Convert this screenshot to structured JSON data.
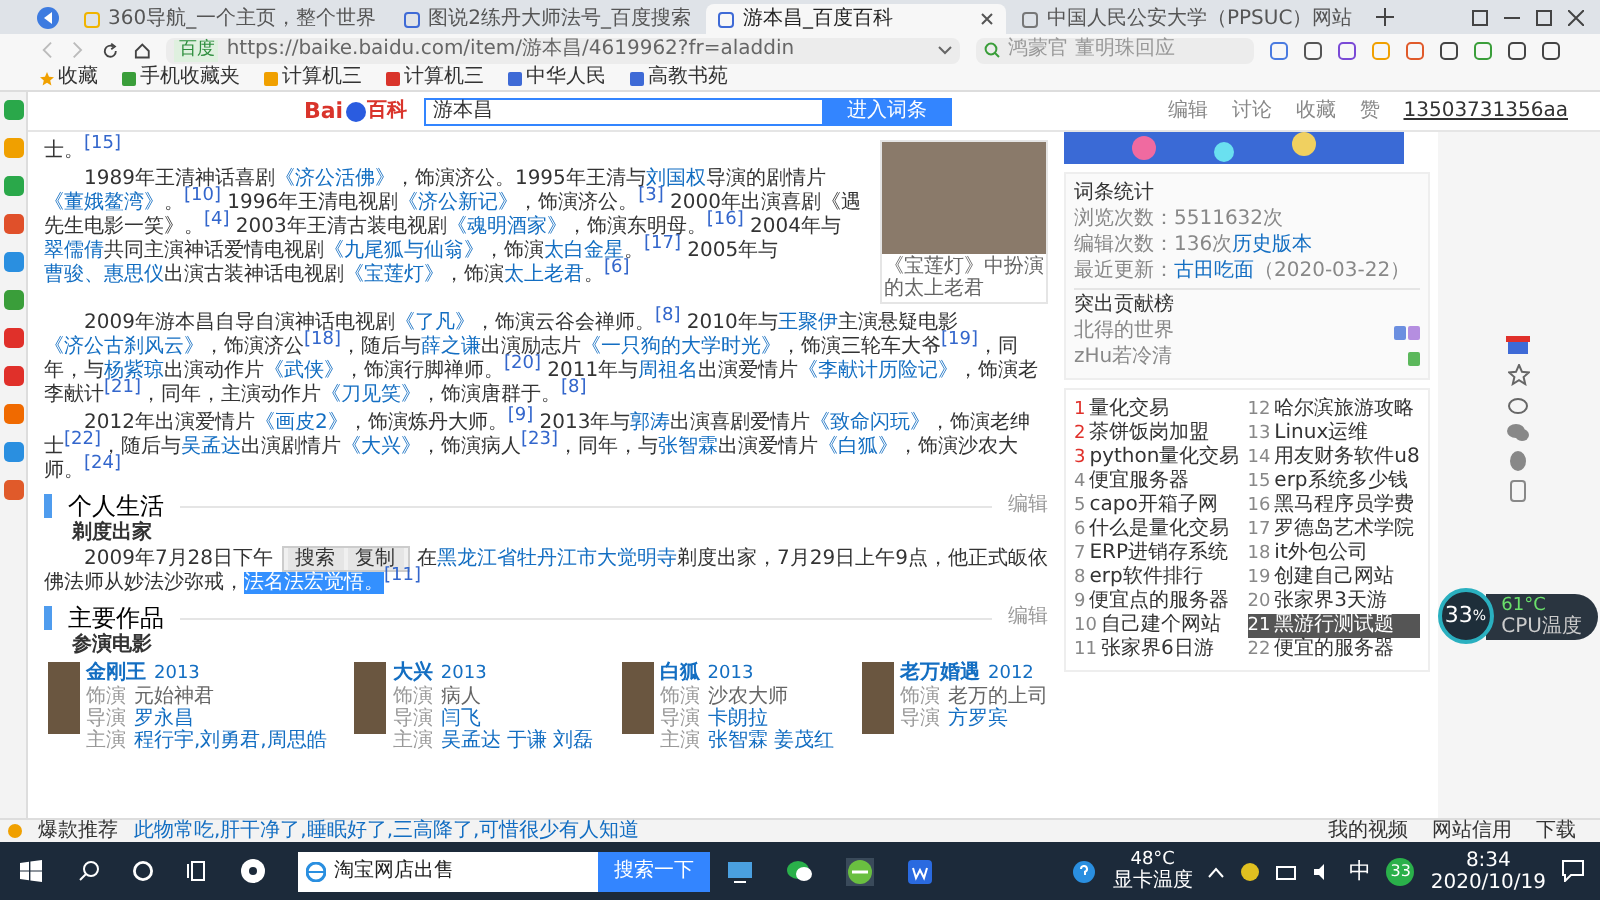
{
  "browser": {
    "tabs": [
      {
        "title": "360导航_一个主页，整个世界",
        "selected": false
      },
      {
        "title": "图说2练丹大师法号_百度搜索",
        "selected": false
      },
      {
        "title": "游本昌_百度百科",
        "selected": true
      },
      {
        "title": "中国人民公安大学（PPSUC）网站",
        "selected": false
      }
    ],
    "site_label": "百度",
    "url": "https://baike.baidu.com/item/游本昌/4619962?fr=aladdin",
    "search_placeholder": "鸿蒙官 董明珠回应",
    "bookmarks": [
      "收藏",
      "手机收藏夹",
      "计算机三",
      "计算机三",
      "中华人民",
      "高教书苑"
    ]
  },
  "header": {
    "logo_text": "Bai",
    "logo_suffix": "百科",
    "search_value": "游本昌",
    "search_button": "进入词条",
    "actions": [
      "编辑",
      "讨论",
      "收藏",
      "赞"
    ],
    "user": "13503731356aa"
  },
  "article": {
    "photo_caption": "《宝莲灯》中扮演的太上老君",
    "beside_photo": [
      {
        "kind": "paragraph",
        "indent": false,
        "segments": [
          {
            "kind": "plain",
            "text": "士。"
          },
          {
            "kind": "ref",
            "text": "[15]"
          }
        ]
      },
      {
        "kind": "paragraph",
        "indent": true,
        "segments": [
          {
            "kind": "plain",
            "text": "1989年王清神话喜剧"
          },
          {
            "kind": "link",
            "text": "《济公活佛》"
          },
          {
            "kind": "plain",
            "text": "，饰演济公。1995年王清与"
          },
          {
            "kind": "link",
            "text": "刘国权"
          },
          {
            "kind": "plain",
            "text": "导演的剧情片"
          },
          {
            "kind": "link",
            "text": "《董娥鳌湾》"
          },
          {
            "kind": "plain",
            "text": "。"
          },
          {
            "kind": "ref",
            "text": "[10]"
          },
          {
            "kind": "plain",
            "text": " 1996年王清电视剧"
          },
          {
            "kind": "link",
            "text": "《济公新记》"
          },
          {
            "kind": "plain",
            "text": "，饰演济公。"
          },
          {
            "kind": "ref",
            "text": "[3]"
          },
          {
            "kind": "plain",
            "text": " 2000年出演喜剧《遇先生电影一笑》。"
          },
          {
            "kind": "ref",
            "text": "[4]"
          },
          {
            "kind": "plain",
            "text": " 2003年王清古装电视剧"
          },
          {
            "kind": "link",
            "text": "《魂明酒家》"
          },
          {
            "kind": "plain",
            "text": "，饰演东明母。"
          },
          {
            "kind": "ref",
            "text": "[16]"
          },
          {
            "kind": "plain",
            "text": " 2004年与"
          },
          {
            "kind": "link",
            "text": "翠儒倩"
          },
          {
            "kind": "plain",
            "text": "共同主演神话爱情电视剧"
          },
          {
            "kind": "link",
            "text": "《九尾狐与仙翁》"
          },
          {
            "kind": "plain",
            "text": "，饰演"
          },
          {
            "kind": "link",
            "text": "太白金星"
          },
          {
            "kind": "plain",
            "text": "。"
          },
          {
            "kind": "ref",
            "text": "[17]"
          },
          {
            "kind": "plain",
            "text": " 2005年与"
          },
          {
            "kind": "link",
            "text": "曹骏、惠思仪"
          },
          {
            "kind": "plain",
            "text": "出演古装神话电视剧"
          },
          {
            "kind": "link",
            "text": "《宝莲灯》"
          },
          {
            "kind": "plain",
            "text": "，饰演"
          },
          {
            "kind": "link",
            "text": "太上老君"
          },
          {
            "kind": "plain",
            "text": "。"
          },
          {
            "kind": "ref",
            "text": "[6]"
          }
        ]
      }
    ],
    "blocks": [
      {
        "kind": "paragraph",
        "indent": true,
        "segments": [
          {
            "kind": "plain",
            "text": "2009年游本昌自导自演神话电视剧"
          },
          {
            "kind": "link",
            "text": "《了凡》"
          },
          {
            "kind": "plain",
            "text": "，饰演云谷会禅师。"
          },
          {
            "kind": "ref",
            "text": "[8]"
          },
          {
            "kind": "plain",
            "text": " 2010年与"
          },
          {
            "kind": "link",
            "text": "王聚伊"
          },
          {
            "kind": "plain",
            "text": "主演悬疑电影"
          },
          {
            "kind": "link",
            "text": "《济公古刹风云》"
          },
          {
            "kind": "plain",
            "text": "，饰演济公"
          },
          {
            "kind": "ref",
            "text": "[18]"
          },
          {
            "kind": "plain",
            "text": "，随后与"
          },
          {
            "kind": "link",
            "text": "薛之谦"
          },
          {
            "kind": "plain",
            "text": "出演励志片"
          },
          {
            "kind": "link",
            "text": "《一只狗的大学时光》"
          },
          {
            "kind": "plain",
            "text": "，饰演三轮车大爷"
          },
          {
            "kind": "ref",
            "text": "[19]"
          },
          {
            "kind": "plain",
            "text": "，同年，与"
          },
          {
            "kind": "link",
            "text": "杨紫琼"
          },
          {
            "kind": "plain",
            "text": "出演动作片"
          },
          {
            "kind": "link",
            "text": "《武侠》"
          },
          {
            "kind": "plain",
            "text": "，饰演行脚禅师。"
          },
          {
            "kind": "ref",
            "text": "[20]"
          },
          {
            "kind": "plain",
            "text": " 2011年与"
          },
          {
            "kind": "link",
            "text": "周祖名"
          },
          {
            "kind": "plain",
            "text": "出演爱情片"
          },
          {
            "kind": "link",
            "text": "《李献计历险记》"
          },
          {
            "kind": "plain",
            "text": "，饰演老李献计"
          },
          {
            "kind": "ref",
            "text": "[21]"
          },
          {
            "kind": "plain",
            "text": "，同年，主演动作片"
          },
          {
            "kind": "link",
            "text": "《刀见笑》"
          },
          {
            "kind": "plain",
            "text": "，饰演唐群于。"
          },
          {
            "kind": "ref",
            "text": "[8]"
          }
        ]
      },
      {
        "kind": "paragraph",
        "indent": true,
        "segments": [
          {
            "kind": "plain",
            "text": "2012年出演爱情片"
          },
          {
            "kind": "link",
            "text": "《画皮2》"
          },
          {
            "kind": "plain",
            "text": "，饰演炼丹大师。"
          },
          {
            "kind": "ref",
            "text": "[9]"
          },
          {
            "kind": "plain",
            "text": " 2013年与"
          },
          {
            "kind": "link",
            "text": "郭涛"
          },
          {
            "kind": "plain",
            "text": "出演喜剧爱情片"
          },
          {
            "kind": "link",
            "text": "《致命闪玩》"
          },
          {
            "kind": "plain",
            "text": "，饰演老绅士"
          },
          {
            "kind": "ref",
            "text": "[22]"
          },
          {
            "kind": "plain",
            "text": "，随后与"
          },
          {
            "kind": "link",
            "text": "吴孟达"
          },
          {
            "kind": "plain",
            "text": "出演剧情片"
          },
          {
            "kind": "link",
            "text": "《大兴》"
          },
          {
            "kind": "plain",
            "text": "，饰演病人"
          },
          {
            "kind": "ref",
            "text": "[23]"
          },
          {
            "kind": "plain",
            "text": "，同年，与"
          },
          {
            "kind": "link",
            "text": "张智霖"
          },
          {
            "kind": "plain",
            "text": "出演爱情片"
          },
          {
            "kind": "link",
            "text": "《白狐》"
          },
          {
            "kind": "plain",
            "text": "，饰演沙农大师。"
          },
          {
            "kind": "ref",
            "text": "[24]"
          }
        ]
      },
      {
        "kind": "heading",
        "text": "个人生活",
        "edit": "编辑"
      },
      {
        "kind": "subheading",
        "text": "剃度出家"
      },
      {
        "kind": "paragraph",
        "indent": true,
        "segments": [
          {
            "kind": "plain",
            "text": "2009年7月28日下午"
          },
          {
            "kind": "popup",
            "buttons": [
              "搜索",
              "复制"
            ]
          },
          {
            "kind": "plain",
            "text": "在"
          },
          {
            "kind": "link",
            "text": "黑龙江省"
          },
          {
            "kind": "link",
            "text": "牡丹江市大觉明寺"
          },
          {
            "kind": "plain",
            "text": "剃度出家，7月29日上午9点，他正式皈依佛法师从妙法沙弥戒，"
          },
          {
            "kind": "selected",
            "text": "法名法宏觉悟。"
          },
          {
            "kind": "ref",
            "text": "[11]"
          }
        ]
      },
      {
        "kind": "heading",
        "text": "主要作品",
        "edit": "编辑"
      },
      {
        "kind": "subheading",
        "text": "参演电影"
      },
      {
        "kind": "movies",
        "items": [
          {
            "title": "金刚王",
            "year": "2013",
            "fields": [
              {
                "label": "饰演",
                "value": "元始神君",
                "link": false
              },
              {
                "label": "导演",
                "value": "罗永昌",
                "link": true
              },
              {
                "label": "主演",
                "value": "程行宇,刘勇君,周思皓",
                "link": true
              }
            ]
          },
          {
            "title": "大兴",
            "year": "2013",
            "fields": [
              {
                "label": "饰演",
                "value": "病人",
                "link": false
              },
              {
                "label": "导演",
                "value": "闫飞",
                "link": true
              },
              {
                "label": "主演",
                "value": "吴孟达 于谦 刘磊",
                "link": true
              }
            ]
          },
          {
            "title": "白狐",
            "year": "2013",
            "fields": [
              {
                "label": "饰演",
                "value": "沙农大师",
                "link": false
              },
              {
                "label": "导演",
                "value": "卡朗拉",
                "link": true
              },
              {
                "label": "主演",
                "value": "张智霖 姜茂红",
                "link": true
              }
            ]
          },
          {
            "title": "老万婚遇",
            "year": "2012",
            "fields": [
              {
                "label": "饰演",
                "value": "老万的上司",
                "link": false
              },
              {
                "label": "导演",
                "value": "方罗宾",
                "link": true
              }
            ]
          }
        ]
      }
    ]
  },
  "sidebar": {
    "stats_title": "词条统计",
    "stats": [
      {
        "label": "浏览次数：",
        "value": "5511632次"
      },
      {
        "label": "编辑次数：",
        "value": "136次",
        "link": "历史版本"
      },
      {
        "label": "最近更新：",
        "value": "古田吃面",
        "date": "（2020-03-22）"
      }
    ],
    "contributors_title": "突出贡献榜",
    "contributors": [
      {
        "name": "北得的世界",
        "badges": [
          {
            "color": "#6c8fe0"
          },
          {
            "color": "#b58ee0"
          }
        ]
      },
      {
        "name": "zHu若冷清",
        "badges": [
          {
            "color": "#5cb85c"
          }
        ]
      }
    ],
    "hot_list": [
      {
        "rank": "1",
        "text": "量化交易",
        "selected": false
      },
      {
        "rank": "2",
        "text": "茶饼饭岗加盟",
        "selected": false
      },
      {
        "rank": "3",
        "text": "python量化交易",
        "selected": false
      },
      {
        "rank": "4",
        "text": "便宜服务器",
        "selected": false
      },
      {
        "rank": "5",
        "text": "capo开箱子网",
        "selected": false
      },
      {
        "rank": "6",
        "text": "什么是量化交易",
        "selected": false
      },
      {
        "rank": "7",
        "text": "ERP进销存系统",
        "selected": false
      },
      {
        "rank": "8",
        "text": "erp软件排行",
        "selected": false
      },
      {
        "rank": "9",
        "text": "便宜点的服务器",
        "selected": false
      },
      {
        "rank": "10",
        "text": "自己建个网站",
        "selected": false
      },
      {
        "rank": "11",
        "text": "张家界6日游",
        "selected": false
      },
      {
        "rank": "12",
        "text": "哈尔滨旅游攻略",
        "selected": false
      },
      {
        "rank": "13",
        "text": "Linux运维",
        "selected": false
      },
      {
        "rank": "14",
        "text": "用友财务软件u8",
        "selected": false
      },
      {
        "rank": "15",
        "text": "erp系统多少钱",
        "selected": false
      },
      {
        "rank": "16",
        "text": "黑马程序员学费",
        "selected": false
      },
      {
        "rank": "17",
        "text": "罗德岛艺术学院",
        "selected": false
      },
      {
        "rank": "18",
        "text": "it外包公司",
        "selected": false
      },
      {
        "rank": "19",
        "text": "创建自己网站",
        "selected": false
      },
      {
        "rank": "20",
        "text": "张家界3天游",
        "selected": false
      },
      {
        "rank": "21",
        "text": "黑游行测试题",
        "selected": true
      },
      {
        "rank": "22",
        "text": "便宜的服务器",
        "selected": false
      }
    ]
  },
  "cpu_widget": {
    "percent": "33",
    "unit": "%",
    "temp": "61°C",
    "label": "CPU温度"
  },
  "news_bar": {
    "label": "爆款推荐",
    "headline": "此物常吃,肝干净了,睡眠好了,三高降了,可惜很少有人知道",
    "links": [
      "我的视频",
      "网站信用",
      "下载"
    ]
  },
  "taskbar": {
    "search_value": "淘宝网店出售",
    "search_button": "搜索一下",
    "gpu_temp": "48°C",
    "gpu_label": "显卡温度",
    "ime": "中",
    "badge": "33",
    "time": "8:34",
    "date": "2020/10/19"
  }
}
